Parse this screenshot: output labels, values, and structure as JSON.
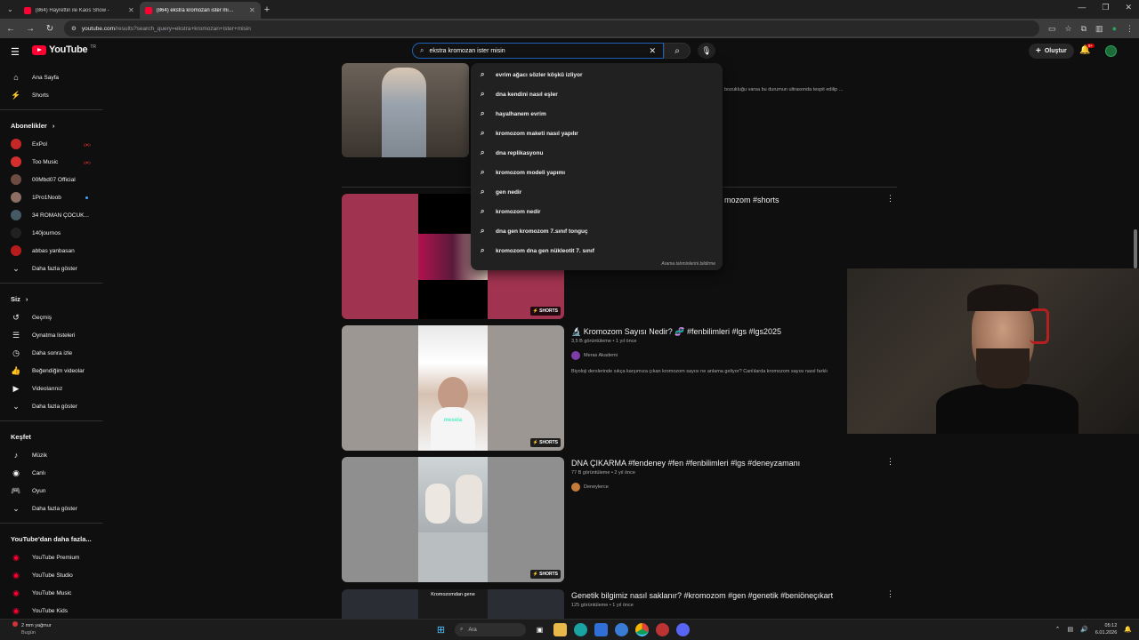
{
  "browser": {
    "tabs": [
      {
        "title": "(864) Hayrettin ile Kaos Show -",
        "active": false
      },
      {
        "title": "(864) ekstra kromozan ister mi…",
        "active": true
      }
    ],
    "url_host": "youtube.com",
    "url_path": "/results?search_query=ekstra+kromozan+ister+misin"
  },
  "header": {
    "logo_text": "YouTube",
    "logo_region": "TR",
    "search_value": "ekstra kromozan ister misin",
    "create_label": "Oluştur",
    "notif_count": "9+"
  },
  "sidebar": {
    "main": [
      {
        "label": "Ana Sayfa",
        "icon": "home-icon",
        "glyph": "⌂"
      },
      {
        "label": "Shorts",
        "icon": "shorts-icon",
        "glyph": "⚡"
      }
    ],
    "subs_title": "Abonelikler",
    "subs": [
      {
        "label": "ExPol",
        "color": "#c62828",
        "badge": "live"
      },
      {
        "label": "Too Music",
        "color": "#d32f2f",
        "badge": "live"
      },
      {
        "label": "00Mbd07 Official",
        "color": "#6d4c41",
        "badge": ""
      },
      {
        "label": "1Pro1Noob",
        "color": "#8d6e63",
        "badge": "dot"
      },
      {
        "label": "34 ROMAN ÇOCUK...",
        "color": "#455a64",
        "badge": ""
      },
      {
        "label": "140journos",
        "color": "#212121",
        "badge": ""
      },
      {
        "label": "abbas yanbasan",
        "color": "#b71c1c",
        "badge": ""
      },
      {
        "label": "Daha fazla göster",
        "color": "",
        "badge": ""
      }
    ],
    "you_title": "Siz",
    "you": [
      {
        "label": "Geçmiş",
        "glyph": "↺"
      },
      {
        "label": "Oynatma listeleri",
        "glyph": "☰"
      },
      {
        "label": "Daha sonra izle",
        "glyph": "◷"
      },
      {
        "label": "Beğendiğim videolar",
        "glyph": "👍"
      },
      {
        "label": "Videolarınız",
        "glyph": "▶"
      },
      {
        "label": "Daha fazla göster",
        "glyph": "⌄"
      }
    ],
    "explore_title": "Keşfet",
    "explore": [
      {
        "label": "Müzik",
        "glyph": "♪"
      },
      {
        "label": "Canlı",
        "glyph": "◉"
      },
      {
        "label": "Oyun",
        "glyph": "🎮"
      },
      {
        "label": "Daha fazla göster",
        "glyph": "⌄"
      }
    ],
    "more_title": "YouTube'dan daha fazla...",
    "more": [
      {
        "label": "YouTube Premium"
      },
      {
        "label": "YouTube Studio"
      },
      {
        "label": "YouTube Music"
      },
      {
        "label": "YouTube Kids"
      }
    ]
  },
  "suggestions": [
    "evrim ağacı sözler köşkü izliyor",
    "dna kendini nasıl eşler",
    "hayalhanem evrim",
    "kromozom maketi nasıl yapılır",
    "dna replikasyonu",
    "kromozom modeli yapımı",
    "gen nedir",
    "kromozom nedir",
    "dna gen kromozom 7.sınıf tonguç",
    "kromozom dna gen nükleotit 7. sınıf"
  ],
  "suggest_report": "Arama tahminlerini bildirme",
  "results": {
    "r0_desc": "bozukluğu varsa bu durumun ultrasonda tespit edilip ...",
    "r1_title": "mozom #shorts",
    "shorts_label": "SHORTS",
    "r2": {
      "title": "🔬 Kromozom Sayısı Nedir? 🧬 #fenbilimleri #lgs #lgs2025",
      "meta": "3,5 B görüntüleme • 1 yıl önce",
      "channel": "Meras Akademi",
      "desc": "Biyoloji derslerinde sıkça karşımıza çıkan kromozom sayısı ne anlama geliyor? Canlılarda kromozom sayısı nasıl farklı",
      "caption": "mesela"
    },
    "r3": {
      "title": "DNA ÇIKARMA #fendeney #fen #fenbilimleri #lgs #deneyzamanı",
      "meta": "77 B görüntüleme • 2 yıl önce",
      "channel": "Deneylerce"
    },
    "r4": {
      "title": "Genetik bilgimiz nasıl saklanır? #kromozom #gen #genetik #beniöneçıkart",
      "meta": "125 görüntüleme • 1 yıl önce",
      "thumb_text": "Kromozomdan gene"
    }
  },
  "taskbar": {
    "weather_line1": "2 mm yağmur",
    "weather_line2": "Bugün",
    "search_placeholder": "Ara",
    "time": "05:12",
    "date": "6.01.2026"
  }
}
